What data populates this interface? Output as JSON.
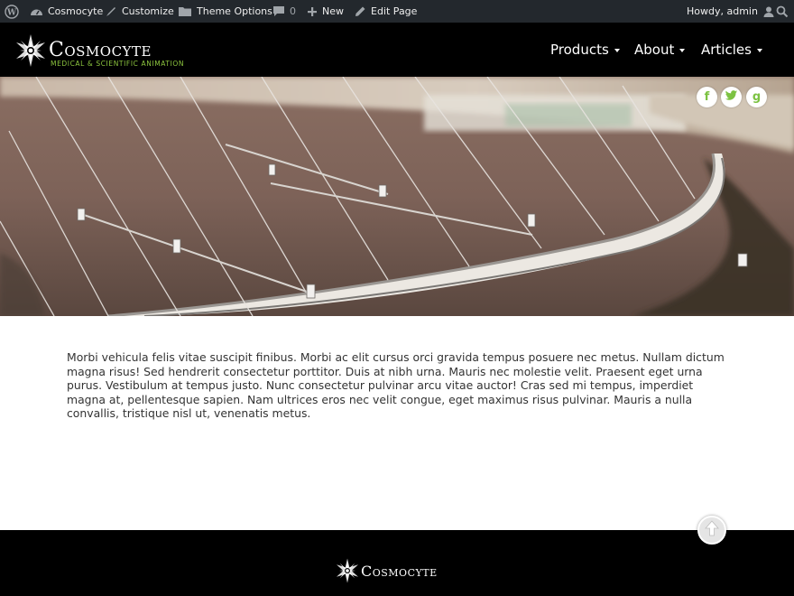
{
  "adminbar": {
    "wp_logo_icon": "wordpress-icon",
    "site_name": "Cosmocyte",
    "customize": "Customize",
    "theme_options": "Theme Options",
    "comments_count": "0",
    "new_label": "New",
    "edit_page": "Edit Page",
    "howdy": "Howdy, admin"
  },
  "header": {
    "logo_name": "Cosmocyte",
    "logo_tagline": "MEDICAL & SCIENTIFIC ANIMATION",
    "nav": [
      {
        "label": "Products"
      },
      {
        "label": "About"
      },
      {
        "label": "Articles"
      }
    ]
  },
  "social": [
    {
      "icon": "facebook-icon",
      "glyph": "f"
    },
    {
      "icon": "twitter-icon",
      "glyph": "t"
    },
    {
      "icon": "google-plus-icon",
      "glyph": "g"
    }
  ],
  "content": {
    "paragraph": "Morbi vehicula felis vitae suscipit finibus. Morbi ac elit cursus orci gravida tempus posuere nec metus. Nullam dictum magna risus! Sed hendrerit consectetur porttitor. Duis at nibh urna. Mauris nec molestie velit. Praesent eget urna purus. Vestibulum at tempus justo. Nunc consectetur pulvinar arcu vitae auctor! Cras sed mi tempus, imperdiet magna at, pellentesque sapien. Nam ultrices eros nec velit congue, eget maximus risus pulvinar. Mauris a nulla convallis, tristique nisl ut, venenatis metus."
  },
  "footer": {
    "logo_name": "Cosmocyte"
  },
  "colors": {
    "adminbar_bg": "#23282d",
    "header_bg": "#000000",
    "accent_green": "#8dc63f",
    "social_green": "#7cc242"
  }
}
